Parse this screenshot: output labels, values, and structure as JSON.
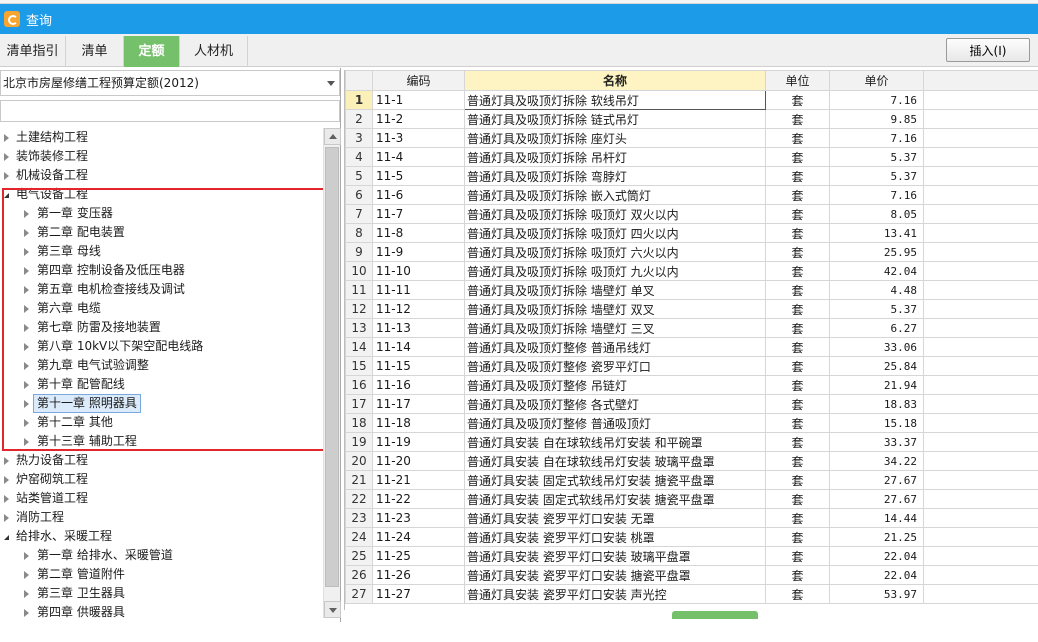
{
  "window": {
    "title": "查询"
  },
  "tabs": [
    {
      "label": "清单指引",
      "active": false
    },
    {
      "label": "清单",
      "active": false
    },
    {
      "label": "定额",
      "active": true
    },
    {
      "label": "人材机",
      "active": false
    }
  ],
  "toolbar": {
    "insert_label": "插入(I)"
  },
  "left_panel": {
    "quota_library": "北京市房屋修缮工程预算定额(2012)",
    "search_value": ""
  },
  "tree": {
    "nodes": [
      {
        "label": "土建结构工程",
        "level": 0,
        "state": "collapsed"
      },
      {
        "label": "装饰装修工程",
        "level": 0,
        "state": "collapsed"
      },
      {
        "label": "机械设备工程",
        "level": 0,
        "state": "collapsed"
      },
      {
        "label": "电气设备工程",
        "level": 0,
        "state": "expanded"
      },
      {
        "label": "第一章 变压器",
        "level": 1,
        "state": "collapsed"
      },
      {
        "label": "第二章 配电装置",
        "level": 1,
        "state": "collapsed"
      },
      {
        "label": "第三章 母线",
        "level": 1,
        "state": "collapsed"
      },
      {
        "label": "第四章 控制设备及低压电器",
        "level": 1,
        "state": "collapsed"
      },
      {
        "label": "第五章 电机检查接线及调试",
        "level": 1,
        "state": "collapsed"
      },
      {
        "label": "第六章 电缆",
        "level": 1,
        "state": "collapsed"
      },
      {
        "label": "第七章 防雷及接地装置",
        "level": 1,
        "state": "collapsed"
      },
      {
        "label": "第八章 10kV以下架空配电线路",
        "level": 1,
        "state": "collapsed"
      },
      {
        "label": "第九章 电气试验调整",
        "level": 1,
        "state": "collapsed"
      },
      {
        "label": "第十章 配管配线",
        "level": 1,
        "state": "collapsed"
      },
      {
        "label": "第十一章 照明器具",
        "level": 1,
        "state": "collapsed",
        "selected": true
      },
      {
        "label": "第十二章 其他",
        "level": 1,
        "state": "collapsed"
      },
      {
        "label": "第十三章 辅助工程",
        "level": 1,
        "state": "collapsed"
      },
      {
        "label": "热力设备工程",
        "level": 0,
        "state": "collapsed"
      },
      {
        "label": "炉窑砌筑工程",
        "level": 0,
        "state": "collapsed"
      },
      {
        "label": "站类管道工程",
        "level": 0,
        "state": "collapsed"
      },
      {
        "label": "消防工程",
        "level": 0,
        "state": "collapsed"
      },
      {
        "label": "给排水、采暖工程",
        "level": 0,
        "state": "expanded"
      },
      {
        "label": "第一章 给排水、采暖管道",
        "level": 1,
        "state": "collapsed"
      },
      {
        "label": "第二章 管道附件",
        "level": 1,
        "state": "collapsed"
      },
      {
        "label": "第三章 卫生器具",
        "level": 1,
        "state": "collapsed"
      },
      {
        "label": "第四章 供暖器具",
        "level": 1,
        "state": "collapsed"
      }
    ]
  },
  "grid": {
    "columns": [
      "编码",
      "名称",
      "单位",
      "单价"
    ],
    "rows": [
      {
        "no": "1",
        "code": "11-1",
        "name": "普通灯具及吸顶灯拆除 软线吊灯",
        "unit": "套",
        "price": "7.16"
      },
      {
        "no": "2",
        "code": "11-2",
        "name": "普通灯具及吸顶灯拆除 链式吊灯",
        "unit": "套",
        "price": "9.85"
      },
      {
        "no": "3",
        "code": "11-3",
        "name": "普通灯具及吸顶灯拆除 座灯头",
        "unit": "套",
        "price": "7.16"
      },
      {
        "no": "4",
        "code": "11-4",
        "name": "普通灯具及吸顶灯拆除 吊杆灯",
        "unit": "套",
        "price": "5.37"
      },
      {
        "no": "5",
        "code": "11-5",
        "name": "普通灯具及吸顶灯拆除 弯脖灯",
        "unit": "套",
        "price": "5.37"
      },
      {
        "no": "6",
        "code": "11-6",
        "name": "普通灯具及吸顶灯拆除 嵌入式筒灯",
        "unit": "套",
        "price": "7.16"
      },
      {
        "no": "7",
        "code": "11-7",
        "name": "普通灯具及吸顶灯拆除 吸顶灯 双火以内",
        "unit": "套",
        "price": "8.05"
      },
      {
        "no": "8",
        "code": "11-8",
        "name": "普通灯具及吸顶灯拆除 吸顶灯 四火以内",
        "unit": "套",
        "price": "13.41"
      },
      {
        "no": "9",
        "code": "11-9",
        "name": "普通灯具及吸顶灯拆除 吸顶灯 六火以内",
        "unit": "套",
        "price": "25.95"
      },
      {
        "no": "10",
        "code": "11-10",
        "name": "普通灯具及吸顶灯拆除 吸顶灯 九火以内",
        "unit": "套",
        "price": "42.04"
      },
      {
        "no": "11",
        "code": "11-11",
        "name": "普通灯具及吸顶灯拆除 墙壁灯 单叉",
        "unit": "套",
        "price": "4.48"
      },
      {
        "no": "12",
        "code": "11-12",
        "name": "普通灯具及吸顶灯拆除 墙壁灯 双叉",
        "unit": "套",
        "price": "5.37"
      },
      {
        "no": "13",
        "code": "11-13",
        "name": "普通灯具及吸顶灯拆除 墙壁灯 三叉",
        "unit": "套",
        "price": "6.27"
      },
      {
        "no": "14",
        "code": "11-14",
        "name": "普通灯具及吸顶灯整修 普通吊线灯",
        "unit": "套",
        "price": "33.06"
      },
      {
        "no": "15",
        "code": "11-15",
        "name": "普通灯具及吸顶灯整修 瓷罗平灯口",
        "unit": "套",
        "price": "25.84"
      },
      {
        "no": "16",
        "code": "11-16",
        "name": "普通灯具及吸顶灯整修 吊链灯",
        "unit": "套",
        "price": "21.94"
      },
      {
        "no": "17",
        "code": "11-17",
        "name": "普通灯具及吸顶灯整修 各式壁灯",
        "unit": "套",
        "price": "18.83"
      },
      {
        "no": "18",
        "code": "11-18",
        "name": "普通灯具及吸顶灯整修 普通吸顶灯",
        "unit": "套",
        "price": "15.18"
      },
      {
        "no": "19",
        "code": "11-19",
        "name": "普通灯具安装 自在球软线吊灯安装 和平碗罩",
        "unit": "套",
        "price": "33.37"
      },
      {
        "no": "20",
        "code": "11-20",
        "name": "普通灯具安装 自在球软线吊灯安装 玻璃平盘罩",
        "unit": "套",
        "price": "34.22"
      },
      {
        "no": "21",
        "code": "11-21",
        "name": "普通灯具安装 固定式软线吊灯安装 搪瓷平盘罩",
        "unit": "套",
        "price": "27.67"
      },
      {
        "no": "22",
        "code": "11-22",
        "name": "普通灯具安装 固定式软线吊灯安装 搪瓷平盘罩",
        "unit": "套",
        "price": "27.67"
      },
      {
        "no": "23",
        "code": "11-23",
        "name": "普通灯具安装 瓷罗平灯口安装 无罩",
        "unit": "套",
        "price": "14.44"
      },
      {
        "no": "24",
        "code": "11-24",
        "name": "普通灯具安装 瓷罗平灯口安装 桃罩",
        "unit": "套",
        "price": "21.25"
      },
      {
        "no": "25",
        "code": "11-25",
        "name": "普通灯具安装 瓷罗平灯口安装 玻璃平盘罩",
        "unit": "套",
        "price": "22.04"
      },
      {
        "no": "26",
        "code": "11-26",
        "name": "普通灯具安装 瓷罗平灯口安装 搪瓷平盘罩",
        "unit": "套",
        "price": "22.04"
      },
      {
        "no": "27",
        "code": "11-27",
        "name": "普通灯具安装 瓷罗平灯口安装 声光控",
        "unit": "套",
        "price": "53.97"
      }
    ]
  },
  "colors": {
    "titlebar": "#1c9be8",
    "active_tab": "#75c06b",
    "highlight_box": "#e3262c"
  }
}
